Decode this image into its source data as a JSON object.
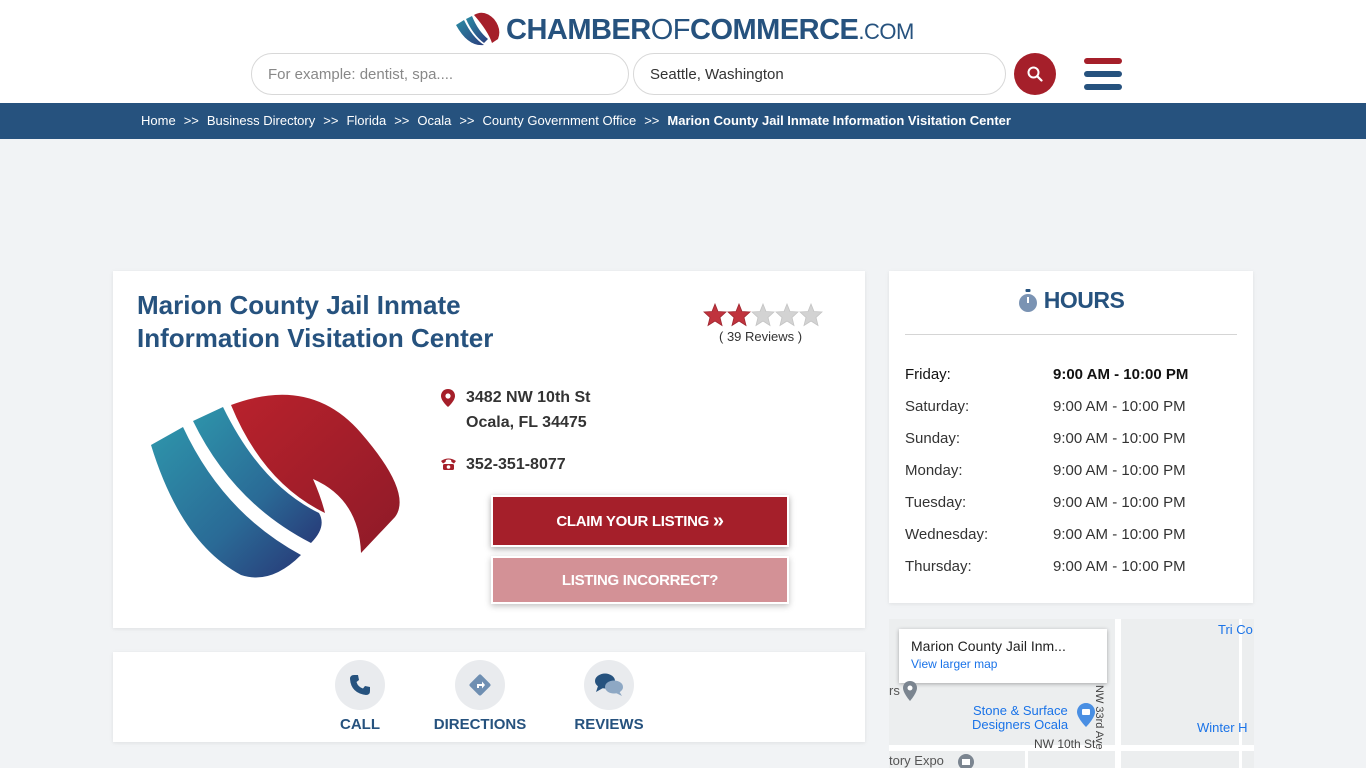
{
  "brand": {
    "part1": "CHAMBER",
    "part2": "OF",
    "part3": "COMMERCE",
    "part4": ".COM"
  },
  "search": {
    "what_placeholder": "For example: dentist, spa....",
    "where_value": "Seattle, Washington"
  },
  "breadcrumb": [
    "Home",
    "Business Directory",
    "Florida",
    "Ocala",
    "County Government Office",
    "Marion County Jail Inmate Information Visitation Center"
  ],
  "breadcrumb_sep": ">>",
  "business": {
    "title": "Marion County Jail Inmate Information Visitation Center",
    "rating": 2,
    "rating_max": 5,
    "reviews": "( 39 Reviews )",
    "address_line1": "3482 NW 10th St",
    "address_line2": "Ocala, FL 34475",
    "phone": "352-351-8077",
    "claim_label": "CLAIM YOUR LISTING",
    "claim_arrow": "»",
    "incorrect_label": "LISTING INCORRECT?"
  },
  "actions": [
    {
      "label": "CALL",
      "icon": "phone-icon"
    },
    {
      "label": "DIRECTIONS",
      "icon": "directions-icon"
    },
    {
      "label": "REVIEWS",
      "icon": "chat-icon"
    }
  ],
  "hours": {
    "title": "HOURS",
    "rows": [
      {
        "day": "Friday:",
        "hours": "9:00 AM - 10:00 PM",
        "today": true
      },
      {
        "day": "Saturday:",
        "hours": "9:00 AM - 10:00 PM"
      },
      {
        "day": "Sunday:",
        "hours": "9:00 AM - 10:00 PM"
      },
      {
        "day": "Monday:",
        "hours": "9:00 AM - 10:00 PM"
      },
      {
        "day": "Tuesday:",
        "hours": "9:00 AM - 10:00 PM"
      },
      {
        "day": "Wednesday:",
        "hours": "9:00 AM - 10:00 PM"
      },
      {
        "day": "Thursday:",
        "hours": "9:00 AM - 10:00 PM"
      }
    ]
  },
  "map": {
    "place_name": "Marion County Jail Inm...",
    "view_larger": "View larger map",
    "labels": {
      "tri_co": "Tri Co",
      "store_line1": "Stone & Surface",
      "store_line2": "Designers Ocala",
      "street_h": "NW 10th St",
      "street_v": "NW 33rd Ave",
      "winter": "Winter H",
      "expo": "tory Expo",
      "rs": "rs"
    }
  },
  "colors": {
    "brand_blue": "#26527e",
    "brand_red": "#a51f2a",
    "incorrect_pink": "#d39196"
  }
}
